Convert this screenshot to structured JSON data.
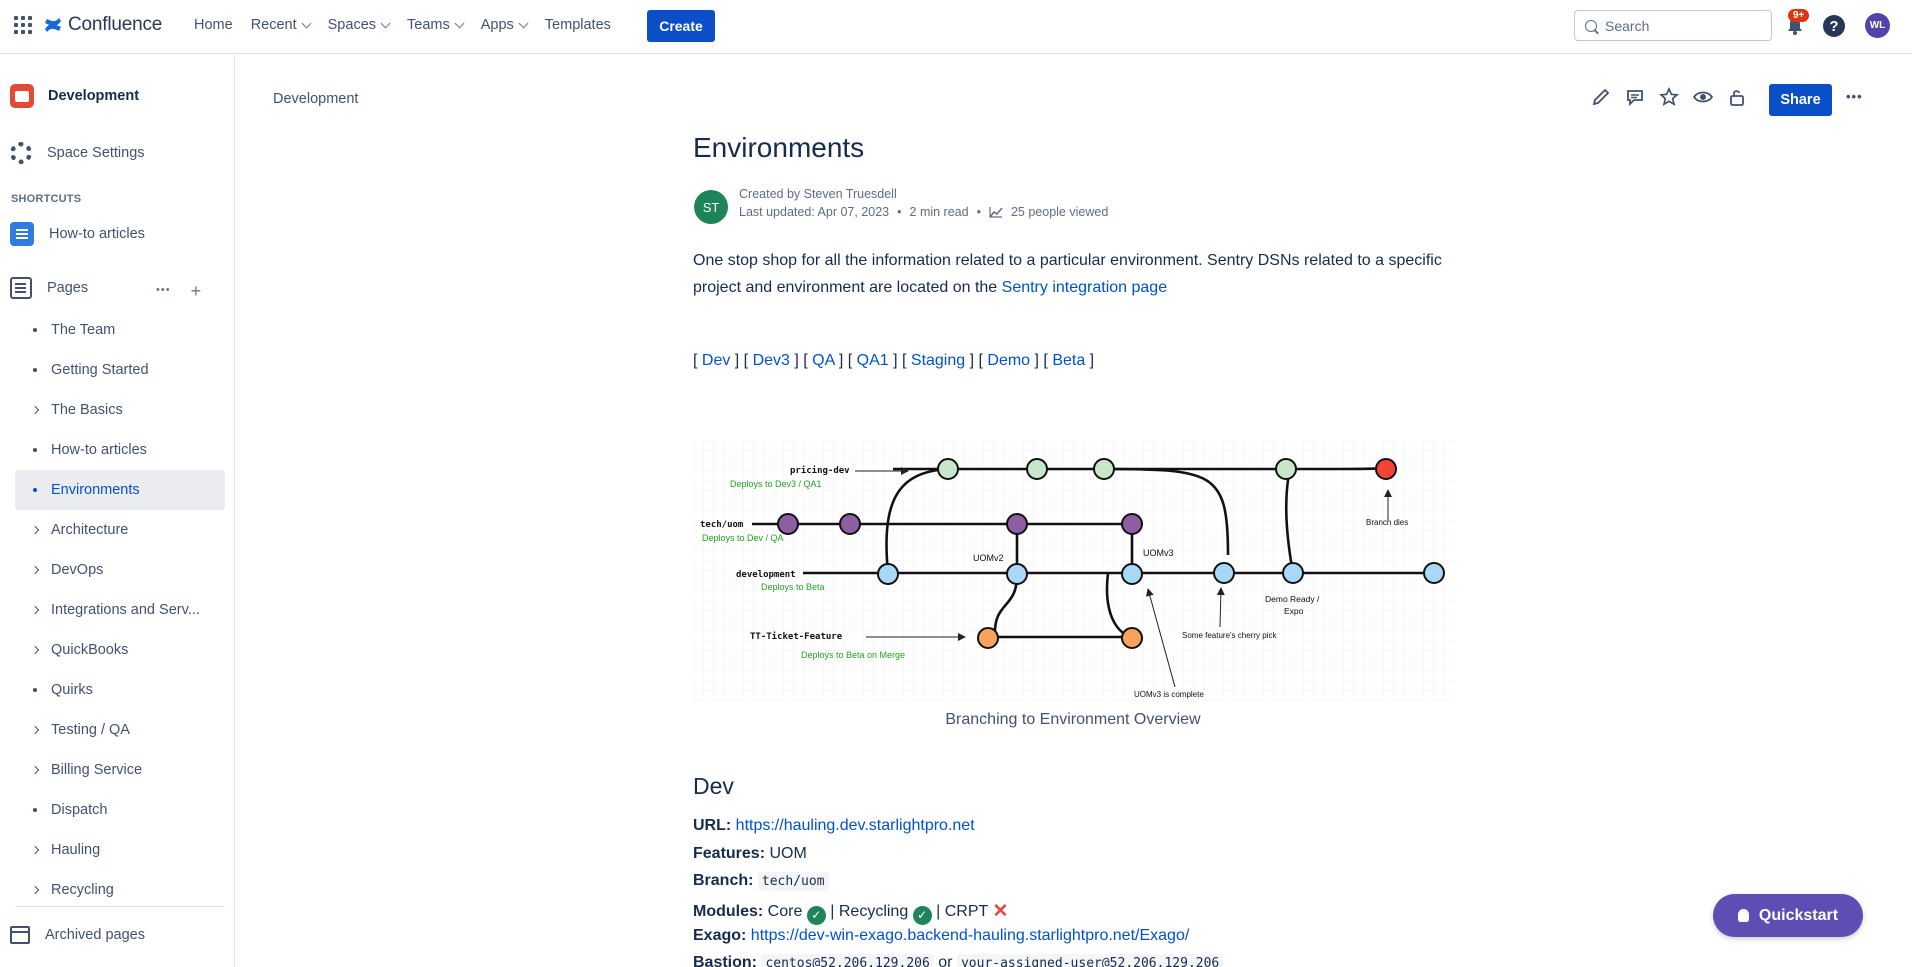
{
  "topnav": {
    "logo_text": "Confluence",
    "items": [
      {
        "label": "Home",
        "dropdown": false
      },
      {
        "label": "Recent",
        "dropdown": true
      },
      {
        "label": "Spaces",
        "dropdown": true
      },
      {
        "label": "Teams",
        "dropdown": true
      },
      {
        "label": "Apps",
        "dropdown": true
      },
      {
        "label": "Templates",
        "dropdown": false
      }
    ],
    "create_label": "Create",
    "search_placeholder": "Search",
    "notifications_badge": "9+",
    "help_label": "?",
    "user_initials": "WL",
    "brand_color": "#0b4fc8"
  },
  "sidebar": {
    "space_name": "Development",
    "space_settings": "Space Settings",
    "shortcuts_label": "SHORTCUTS",
    "shortcut_howto": "How-to articles",
    "pages_label": "Pages",
    "pages_more": "•••",
    "pages_add": "+",
    "tree": [
      {
        "label": "The Team",
        "expandable": false,
        "active": false
      },
      {
        "label": "Getting Started",
        "expandable": false,
        "active": false
      },
      {
        "label": "The Basics",
        "expandable": true,
        "active": false
      },
      {
        "label": "How-to articles",
        "expandable": false,
        "active": false
      },
      {
        "label": "Environments",
        "expandable": false,
        "active": true
      },
      {
        "label": "Architecture",
        "expandable": true,
        "active": false
      },
      {
        "label": "DevOps",
        "expandable": true,
        "active": false
      },
      {
        "label": "Integrations and Serv...",
        "expandable": true,
        "active": false
      },
      {
        "label": "QuickBooks",
        "expandable": true,
        "active": false
      },
      {
        "label": "Quirks",
        "expandable": false,
        "active": false
      },
      {
        "label": "Testing / QA",
        "expandable": true,
        "active": false
      },
      {
        "label": "Billing Service",
        "expandable": true,
        "active": false
      },
      {
        "label": "Dispatch",
        "expandable": false,
        "active": false
      },
      {
        "label": "Hauling",
        "expandable": true,
        "active": false
      },
      {
        "label": "Recycling",
        "expandable": true,
        "active": false
      }
    ],
    "archived_label": "Archived pages"
  },
  "page": {
    "breadcrumb": "Development",
    "share_label": "Share",
    "more_label": "•••",
    "title": "Environments",
    "author_initials": "ST",
    "created_by": "Created by Steven Truesdell",
    "last_updated": "Last updated: Apr 07, 2023",
    "read_time": "2 min read",
    "viewers": "25 people viewed",
    "intro_text": "One stop shop for all the information related to a particular environment. Sentry DSNs related to a specific project and environment are located on the ",
    "intro_link": "Sentry integration page",
    "env_links": [
      "Dev",
      "Dev3",
      "QA",
      "QA1",
      "Staging",
      "Demo",
      "Beta"
    ],
    "caption": "Branching to Environment Overview",
    "dev_heading": "Dev",
    "url_label": "URL:",
    "url_value": "https://hauling.dev.starlightpro.net",
    "features_label": "Features:",
    "features_value": "UOM",
    "branch_label": "Branch:",
    "branch_value": "tech/uom",
    "modules_label": "Modules:",
    "module_core": "Core",
    "module_recycling": "Recycling",
    "module_crpt": "CRPT",
    "exago_label": "Exago:",
    "exago_value": "https://dev-win-exago.backend-hauling.starlightpro.net/Exago/",
    "bastion_label": "Bastion:",
    "bastion_value1": "centos@52.206.129.206",
    "bastion_or": "or",
    "bastion_value2": "your-assigned-user@52.206.129.206"
  },
  "diagram": {
    "labels": {
      "pricing": "pricing-dev",
      "pricing_deploy": "Deploys to Dev3 / QA1",
      "techuom": "tech/uom",
      "techuom_deploy": "Deploys to Dev / QA",
      "development": "development",
      "development_deploy": "Deploys to Beta",
      "feature": "TT-Ticket-Feature",
      "feature_deploy": "Deploys to Beta on Merge",
      "uomv2": "UOMv2",
      "uomv3": "UOMv3",
      "branch_dies": "Branch dies",
      "demo_ready": "Demo Ready /",
      "expo": "Expo",
      "cherry_pick": "Some feature's cherry pick",
      "uomv3_complete": "UOMv3 is complete"
    },
    "colors": {
      "green": "#c8e6c9",
      "purple": "#8e5ea2",
      "blue": "#a8d8f5",
      "orange": "#f7a35c",
      "red": "#f44336",
      "deploy_text": "#22a322"
    }
  },
  "quickstart_label": "Quickstart"
}
